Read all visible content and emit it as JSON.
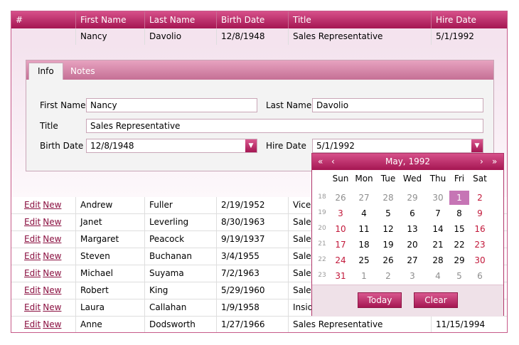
{
  "grid": {
    "columns": [
      "#",
      "First Name",
      "Last Name",
      "Birth Date",
      "Title",
      "Hire Date"
    ],
    "edit_row": {
      "first": "Nancy",
      "last": "Davolio",
      "birth": "12/8/1948",
      "title": "Sales Representative",
      "hire": "5/1/1992"
    },
    "edit_link": "Edit",
    "new_link": "New",
    "rows": [
      {
        "first": "Andrew",
        "last": "Fuller",
        "birth": "2/19/1952",
        "title": "Vice P",
        "hire": ""
      },
      {
        "first": "Janet",
        "last": "Leverling",
        "birth": "8/30/1963",
        "title": "Sales",
        "hire": ""
      },
      {
        "first": "Margaret",
        "last": "Peacock",
        "birth": "9/19/1937",
        "title": "Sales",
        "hire": ""
      },
      {
        "first": "Steven",
        "last": "Buchanan",
        "birth": "3/4/1955",
        "title": "Sales",
        "hire": ""
      },
      {
        "first": "Michael",
        "last": "Suyama",
        "birth": "7/2/1963",
        "title": "Sales",
        "hire": ""
      },
      {
        "first": "Robert",
        "last": "King",
        "birth": "5/29/1960",
        "title": "Sales",
        "hire": ""
      },
      {
        "first": "Laura",
        "last": "Callahan",
        "birth": "1/9/1958",
        "title": "Inside",
        "hire": ""
      },
      {
        "first": "Anne",
        "last": "Dodsworth",
        "birth": "1/27/1966",
        "title": "Sales Representative",
        "hire": "11/15/1994"
      }
    ]
  },
  "form": {
    "tabs": [
      "Info",
      "Notes"
    ],
    "labels": {
      "first": "First Name",
      "last": "Last Name",
      "title": "Title",
      "birth": "Birth Date",
      "hire": "Hire Date"
    },
    "values": {
      "first": "Nancy",
      "last": "Davolio",
      "title": "Sales Representative",
      "birth": "12/8/1948",
      "hire": "5/1/1992"
    }
  },
  "calendar": {
    "title": "May, 1992",
    "nav": {
      "fast_prev": "«",
      "prev": "‹",
      "next": "›",
      "fast_next": "»"
    },
    "days_of_week": [
      "Sun",
      "Mon",
      "Tue",
      "Wed",
      "Thu",
      "Fri",
      "Sat"
    ],
    "week_numbers": [
      "18",
      "19",
      "20",
      "21",
      "22",
      "23"
    ],
    "weeks": [
      [
        "26",
        "27",
        "28",
        "29",
        "30",
        "1",
        "2"
      ],
      [
        "3",
        "4",
        "5",
        "6",
        "7",
        "8",
        "9"
      ],
      [
        "10",
        "11",
        "12",
        "13",
        "14",
        "15",
        "16"
      ],
      [
        "17",
        "18",
        "19",
        "20",
        "21",
        "22",
        "23"
      ],
      [
        "24",
        "25",
        "26",
        "27",
        "28",
        "29",
        "30"
      ],
      [
        "31",
        "1",
        "2",
        "3",
        "4",
        "5",
        "6"
      ]
    ],
    "today_label": "Today",
    "clear_label": "Clear"
  },
  "colors": {
    "accent": "#b8245e",
    "selected_day": "#c675b5",
    "weekend": "#c2183a"
  }
}
